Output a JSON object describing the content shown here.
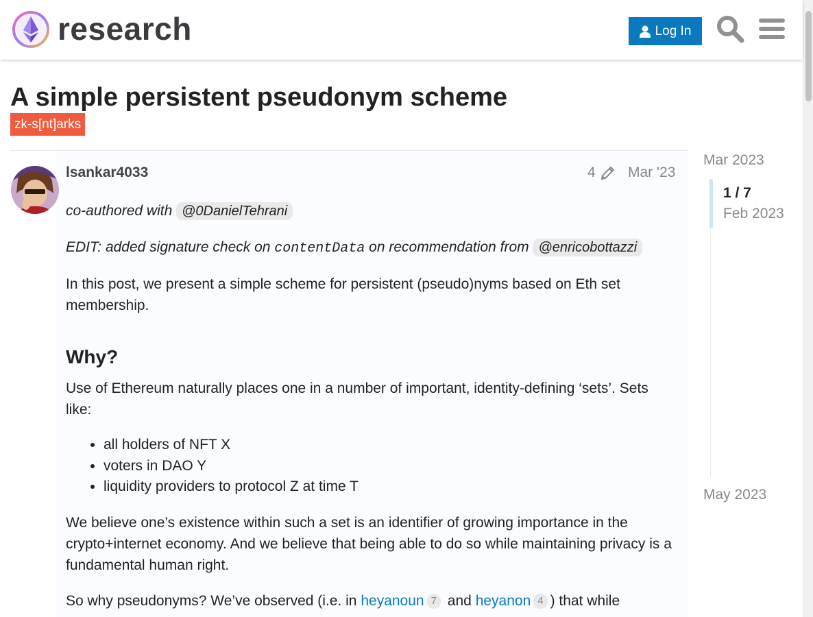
{
  "header": {
    "site_name": "research",
    "login_label": "Log In",
    "icons": [
      "user-icon",
      "search-icon",
      "hamburger-menu-icon"
    ]
  },
  "topic": {
    "title": "A simple persistent pseudonym scheme",
    "tag": "zk-s[nt]arks"
  },
  "post": {
    "username": "lsankar4033",
    "edit_count": "4",
    "date": "Mar '23",
    "coauthor_prefix": "co-authored with",
    "coauthor_mention": "@0DanielTehrani",
    "edit_prefix": "EDIT: added signature check on",
    "edit_code": "contentData",
    "edit_middle": "on recommendation from",
    "edit_mention": "@enricobottazzi",
    "intro": "In this post, we present a simple scheme for persistent (pseudo)nyms based on Eth set membership.",
    "why_heading": "Why?",
    "why_para": "Use of Ethereum naturally places one in a number of important, identity-defining ‘sets’. Sets like:",
    "set_items": [
      "all holders of NFT X",
      "voters in DAO Y",
      "liquidity providers to protocol Z at time T"
    ],
    "belief_para": "We believe one’s existence within such a set is an identifier of growing importance in the crypto+internet economy. And we believe that being able to do so while maintaining privacy is a fundamental human right.",
    "last_prefix": "So why pseudonyms? We’ve observed (i.e. in",
    "link1": "heyanoun",
    "link1_count": "7",
    "last_and": "and",
    "link2": "heyanon",
    "link2_count": "4",
    "last_suffix": ") that while"
  },
  "timeline": {
    "top_date": "Mar 2023",
    "position": "1 / 7",
    "current_date": "Feb 2023",
    "bottom_date": "May 2023"
  },
  "colors": {
    "accent": "#0a79bf",
    "tag": "#f15b3d",
    "post_background": "#fafcff"
  }
}
